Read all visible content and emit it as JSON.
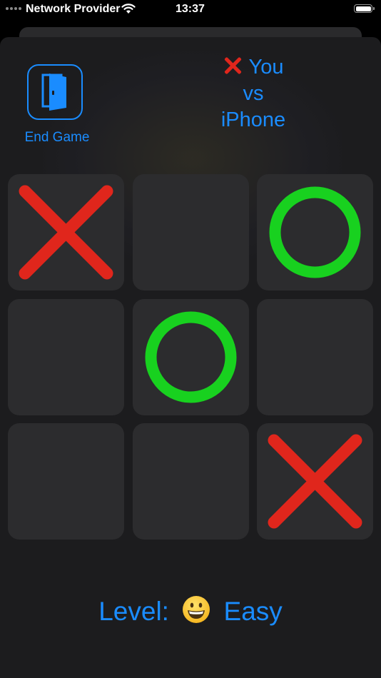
{
  "status_bar": {
    "carrier": "Network Provider",
    "time": "13:37",
    "battery_level": 1.0
  },
  "header": {
    "end_game_label": "End Game",
    "end_game_icon": "door-icon",
    "player_mark": "X",
    "player_label": "You",
    "vs_label": "vs",
    "opponent_label": "iPhone"
  },
  "board": {
    "cells": [
      "X",
      "",
      "O",
      "",
      "O",
      "",
      "",
      "",
      "X"
    ],
    "x_color": "#e0261c",
    "o_color": "#18d11f"
  },
  "level": {
    "prefix": "Level:",
    "emoji": "grinning-face-icon",
    "name": "Easy"
  },
  "colors": {
    "accent": "#1a8cff",
    "background": "#1c1c1e",
    "cell": "#2c2c2e"
  }
}
